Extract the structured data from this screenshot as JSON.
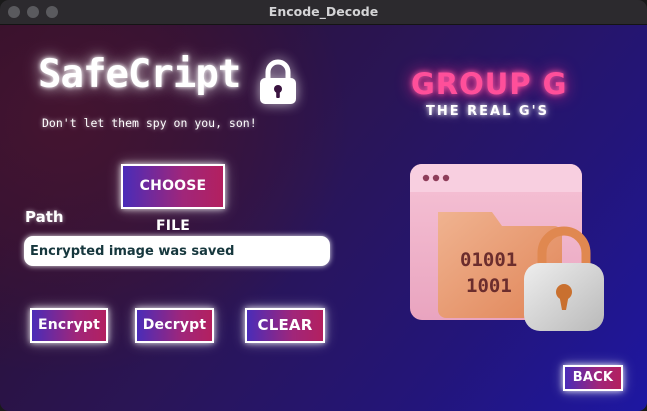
{
  "window": {
    "title": "Encode_Decode"
  },
  "brand": {
    "logo_text": "SafeCript",
    "tagline": "Don't let them spy on you, son!",
    "group_title": "GROUP G",
    "group_subtitle": "THE REAL G'S"
  },
  "file": {
    "choose_label": "CHOOSE FILE",
    "path_label": "Path",
    "path_value": "Encrypted image was saved"
  },
  "actions": {
    "encrypt_label": "Encrypt",
    "decrypt_label": "Decrypt",
    "clear_label": "CLEAR",
    "back_label": "BACK"
  },
  "illustration": {
    "binary_line_1": "01001",
    "binary_line_2": "1001"
  },
  "icons": [
    "close-light",
    "minimize-light",
    "zoom-light",
    "padlock-icon",
    "folder-lock-illustration"
  ],
  "colors": {
    "accent_pink": "#ff4f9a",
    "button_gradient_start": "#4a2cb8",
    "button_gradient_end": "#b3205f",
    "path_text": "#16373d"
  }
}
